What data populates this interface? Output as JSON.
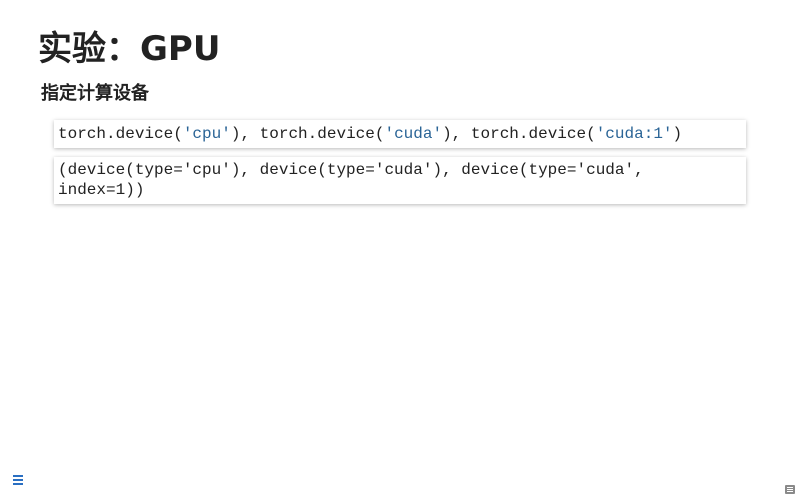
{
  "slide": {
    "title": "实验：GPU",
    "subtitle": "指定计算设备"
  },
  "code_input": {
    "tokens": [
      {
        "text": "torch.device(",
        "kind": "plain"
      },
      {
        "text": "'cpu'",
        "kind": "string"
      },
      {
        "text": "), torch.device(",
        "kind": "plain"
      },
      {
        "text": "'cuda'",
        "kind": "string"
      },
      {
        "text": "), torch.device(",
        "kind": "plain"
      },
      {
        "text": "'cuda:1'",
        "kind": "string"
      },
      {
        "text": ")",
        "kind": "plain"
      }
    ]
  },
  "code_output": {
    "lines": [
      "(device(type='cpu'), device(type='cuda'), device(type='cuda',",
      "index=1))"
    ]
  },
  "colors": {
    "string_token": "#2a6496",
    "menu_icon": "#2a6fc2"
  },
  "icons": {
    "menu": "menu-icon",
    "corner": "slideshow-icon"
  }
}
